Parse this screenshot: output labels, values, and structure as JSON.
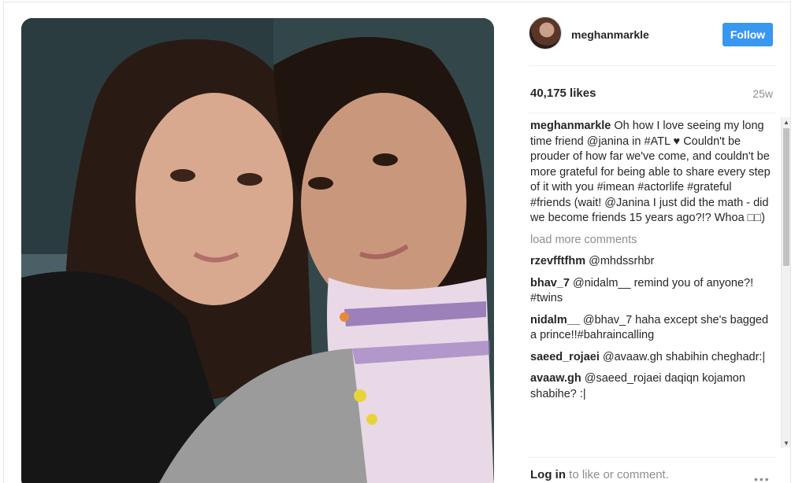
{
  "post": {
    "username": "meghanmarkle",
    "follow_label": "Follow",
    "likes": "40,175 likes",
    "age": "25w"
  },
  "comments": {
    "caption": {
      "user": "meghanmarkle",
      "text": "Oh how I love seeing my long time friend @janina in #ATL ♥ Couldn't be prouder of how far we've come, and couldn't be more grateful for being able to share every step of it with you #imean #actorlife #grateful #friends (wait! @Janina I just did the math - did we become friends 15 years ago?!? Whoa □□)"
    },
    "load_more": "load more comments",
    "items": [
      {
        "user": "rzevfftfhm",
        "text": "@mhdssrhbr"
      },
      {
        "user": "bhav_7",
        "text": "@nidalm__ remind you of anyone?! #twins"
      },
      {
        "user": "nidalm__",
        "text": "@bhav_7 haha except she's bagged a prince!!#bahraincalling"
      },
      {
        "user": "saeed_rojaei",
        "text": "@avaaw.gh shabihin cheghadr:|"
      },
      {
        "user": "avaaw.gh",
        "text": "@saeed_rojaei daqiqn kojamon shabihe? :|"
      }
    ]
  },
  "footer": {
    "login_label": "Log in",
    "suffix": " to like or comment.",
    "more_icon": "•••"
  },
  "scrollbar": {
    "up_arrow": "▲",
    "down_arrow": "▼"
  }
}
